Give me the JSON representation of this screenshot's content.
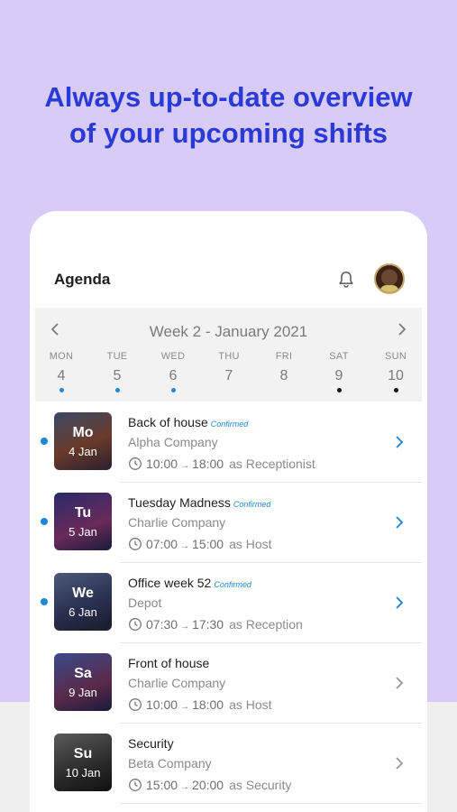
{
  "headline": {
    "line1": "Always up-to-date overview",
    "line2": "of your upcoming shifts"
  },
  "appbar": {
    "title": "Agenda",
    "bell_icon": "bell-icon",
    "avatar": "user-avatar"
  },
  "week": {
    "label": "Week 2 - January 2021",
    "prev_icon": "chevron-left-icon",
    "next_icon": "chevron-right-icon",
    "days": [
      {
        "name": "MON",
        "num": "4",
        "dot": "#1e88d8"
      },
      {
        "name": "TUE",
        "num": "5",
        "dot": "#1e88d8"
      },
      {
        "name": "WED",
        "num": "6",
        "dot": "#1e88d8"
      },
      {
        "name": "THU",
        "num": "7",
        "dot": ""
      },
      {
        "name": "FRI",
        "num": "8",
        "dot": ""
      },
      {
        "name": "SAT",
        "num": "9",
        "dot": "#111111"
      },
      {
        "name": "SUN",
        "num": "10",
        "dot": "#111111"
      }
    ]
  },
  "shifts": [
    {
      "abbr": "Mo",
      "date": "4 Jan",
      "title": "Back of house",
      "status": "Confirmed",
      "company": "Alpha Company",
      "start": "10:00",
      "end": "18:00",
      "role": "as Receptionist",
      "unread": true,
      "chevron_color": "#1e88d8"
    },
    {
      "abbr": "Tu",
      "date": "5 Jan",
      "title": "Tuesday Madness",
      "status": "Confirmed",
      "company": "Charlie Company",
      "start": "07:00",
      "end": "15:00",
      "role": "as Host",
      "unread": true,
      "chevron_color": "#1e88d8"
    },
    {
      "abbr": "We",
      "date": "6 Jan",
      "title": "Office week 52",
      "status": "Confirmed",
      "company": "Depot",
      "start": "07:30",
      "end": "17:30",
      "role": "as Reception",
      "unread": true,
      "chevron_color": "#1e88d8"
    },
    {
      "abbr": "Sa",
      "date": "9 Jan",
      "title": "Front of house",
      "status": "",
      "company": "Charlie Company",
      "start": "10:00",
      "end": "18:00",
      "role": "as Host",
      "unread": false,
      "chevron_color": "#9a9a9a"
    },
    {
      "abbr": "Su",
      "date": "10 Jan",
      "title": "Security",
      "status": "",
      "company": "Beta Company",
      "start": "15:00",
      "end": "20:00",
      "role": "as Security",
      "unread": false,
      "chevron_color": "#9a9a9a"
    }
  ],
  "arrow_glyph": "→",
  "colors": {
    "accent": "#1e88d8",
    "headline": "#2a3ad6",
    "background": "#d8cbf6"
  }
}
